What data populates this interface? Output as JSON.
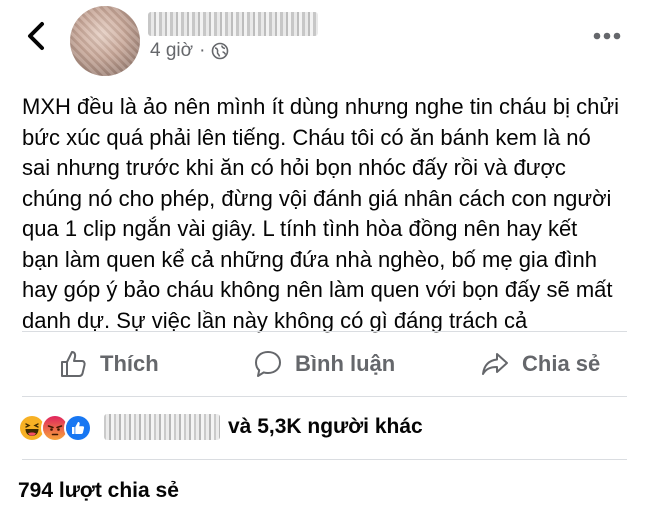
{
  "header": {
    "time": "4 giờ",
    "separator": "·",
    "back_icon": "chevron-left-icon",
    "privacy_icon": "globe-icon",
    "more_icon": "more-dots-icon"
  },
  "post": {
    "text": "MXH đều là ảo nên mình ít dùng nhưng nghe tin cháu bị chửi\nbức xúc quá phải lên tiếng. Cháu tôi có ăn bánh kem là nó\nsai nhưng trước khi ăn có hỏi bọn nhóc đấy rồi và được\nchúng nó cho phép, đừng vội đánh giá nhân cách con người\nqua 1 clip ngắn vài giây. L   tính tình hòa đồng nên hay kết\nbạn làm quen kể cả những đứa nhà nghèo, bố mẹ gia đình\nhay góp ý bảo cháu không nên làm quen với bọn đấy sẽ mất\ndanh dự. Sự việc lần này không có gì đáng trách cả"
  },
  "actions": {
    "like_label": "Thích",
    "comment_label": "Bình luận",
    "share_label": "Chia sẻ"
  },
  "reactions": {
    "icons": [
      "haha-icon",
      "angry-icon",
      "like-icon"
    ],
    "others_text": "và 5,3K người khác"
  },
  "shares": {
    "text": "794 lượt chia sẻ"
  },
  "colors": {
    "secondary_text": "#65676b",
    "divider": "#dadde1",
    "like_blue": "#1877f2",
    "haha_yellow": "#f7b125",
    "angry_red": "#e9710f"
  }
}
